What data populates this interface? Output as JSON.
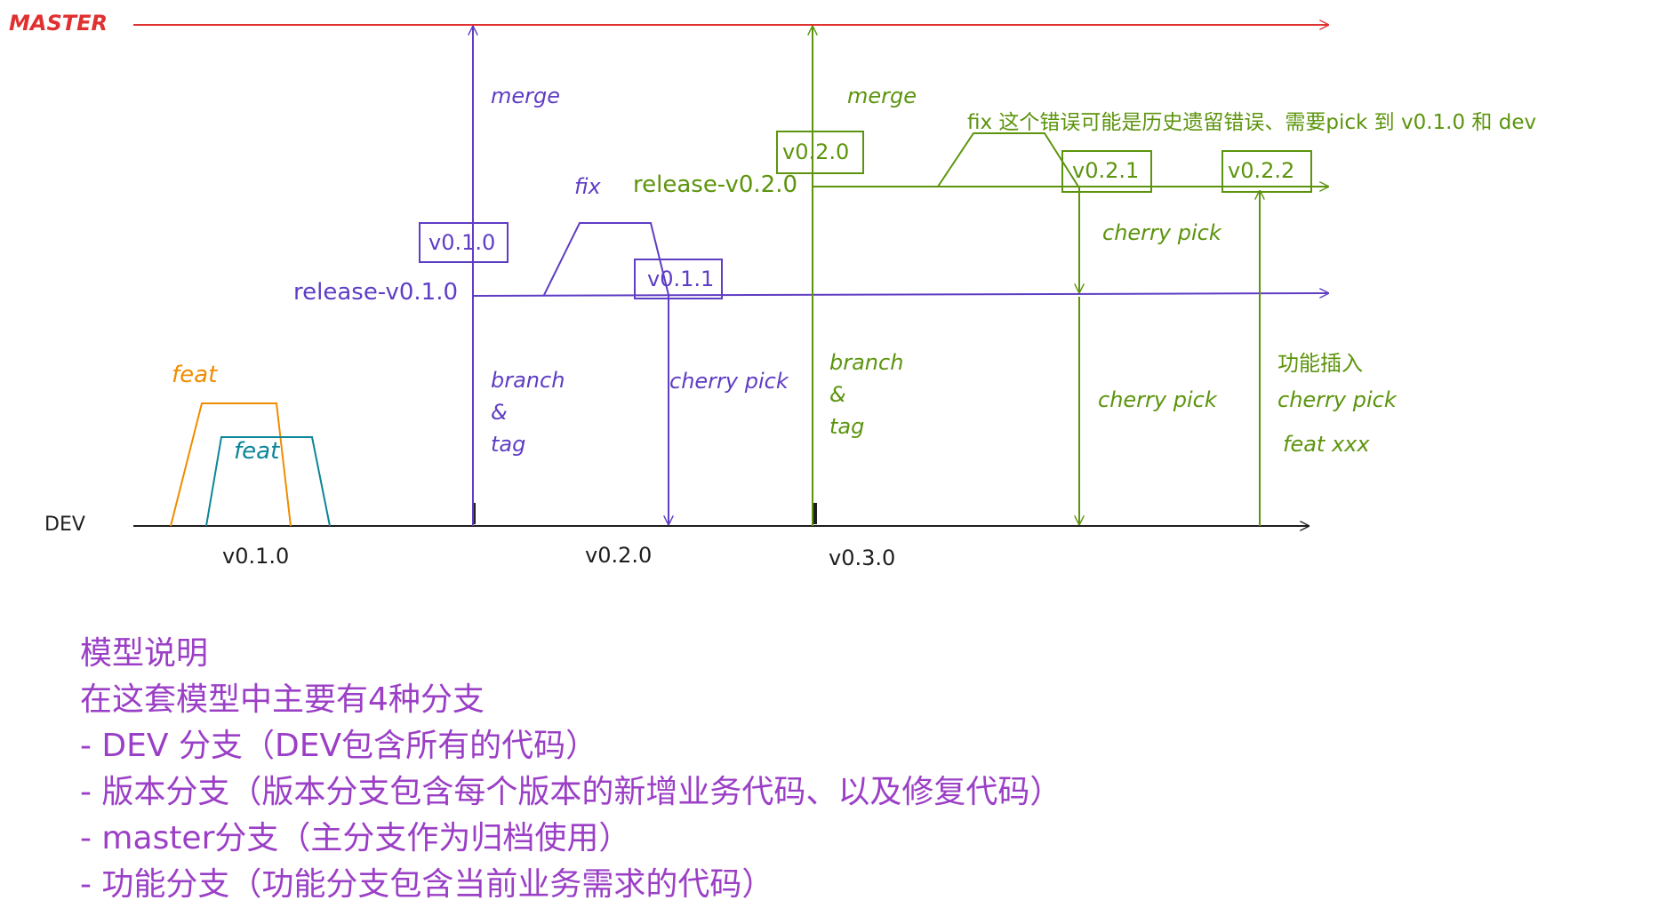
{
  "colors": {
    "master": "#e03131",
    "release1": "#5f3dc4",
    "release2": "#5c940d",
    "dev": "#1e1e1e",
    "feat1": "#f08c00",
    "feat2": "#0c8599",
    "notes": "#9b3fc6"
  },
  "branches": {
    "master": "MASTER",
    "dev": "DEV",
    "release1": "release-v0.1.0",
    "release2": "release-v0.2.0",
    "feat_a": "feat",
    "feat_b": "feat"
  },
  "dev_versions": [
    "v0.1.0",
    "v0.2.0",
    "v0.3.0"
  ],
  "tags": {
    "r1_v010": "v0.1.0",
    "r1_v011": "v0.1.1",
    "r2_v020": "v0.2.0",
    "r2_v021": "v0.2.1",
    "r2_v022": "v0.2.2"
  },
  "labels": {
    "merge1": "merge",
    "merge2": "merge",
    "branch1": [
      "branch",
      "&",
      "tag"
    ],
    "branch2": [
      "branch",
      "&",
      "tag"
    ],
    "fix1": "fix",
    "fix2_note": "fix 这个错误可能是历史遗留错误、需要pick 到 v0.1.0 和 dev",
    "cherry1": "cherry pick",
    "cherry2": "cherry pick",
    "cherry3": "cherry pick",
    "feature_insert": [
      "功能插入",
      "cherry pick",
      "feat xxx"
    ]
  },
  "notes": {
    "title": "模型说明",
    "intro": "在这套模型中主要有4种分支",
    "items": [
      "- DEV 分支（DEV包含所有的代码）",
      "- 版本分支（版本分支包含每个版本的新增业务代码、以及修复代码）",
      "- master分支（主分支作为归档使用）",
      "- 功能分支（功能分支包含当前业务需求的代码）"
    ]
  }
}
